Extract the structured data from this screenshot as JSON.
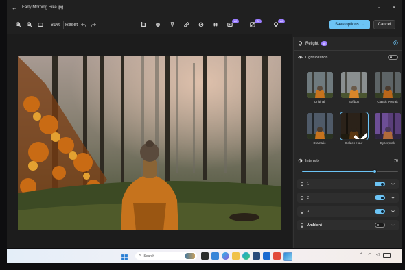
{
  "window": {
    "title": "Early Morning Hike.jpg",
    "zoom": "81%",
    "reset_label": "Reset",
    "save_label": "Save options",
    "cancel_label": "Cancel",
    "ai_badge": "AI"
  },
  "panel": {
    "title": "Relight",
    "ai_badge": "AI",
    "light_location_label": "Light location",
    "light_location_on": false,
    "presets": [
      {
        "label": "Original",
        "selected": false
      },
      {
        "label": "Softbox",
        "selected": false
      },
      {
        "label": "Classic Portrait",
        "selected": false
      },
      {
        "label": "Dramatic",
        "selected": false
      },
      {
        "label": "Golden Hour",
        "selected": true
      },
      {
        "label": "Cyberpunk",
        "selected": false
      }
    ],
    "intensity_label": "Intensity",
    "intensity_value": "76",
    "intensity": 76,
    "lights": [
      {
        "label": "1",
        "on": true
      },
      {
        "label": "2",
        "on": true
      },
      {
        "label": "3",
        "on": true
      },
      {
        "label": "Ambient",
        "on": false
      }
    ]
  },
  "taskbar": {
    "search_placeholder": "Search"
  },
  "colors": {
    "accent": "#6cc4f5",
    "ai_badge": "#9b7dff"
  }
}
